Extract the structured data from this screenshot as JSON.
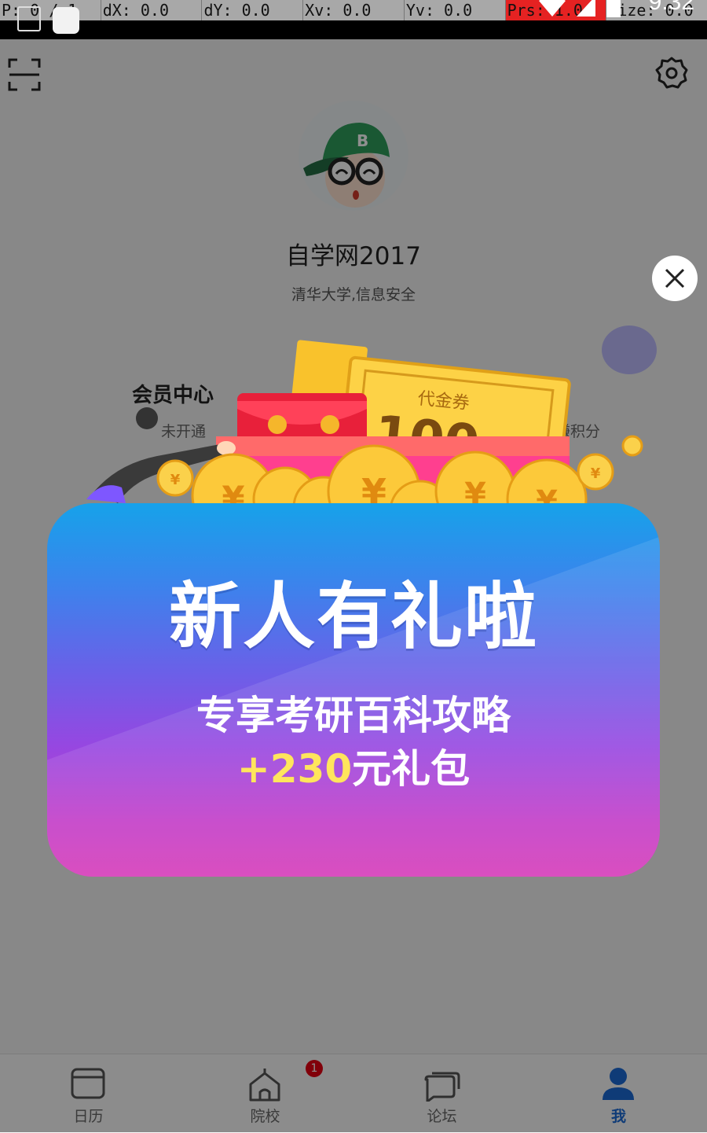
{
  "debug_bar": {
    "pointer": "P: 0 / 1",
    "dx": "dX: 0.0",
    "dy": "dY: 0.0",
    "xv": "Xv: 0.0",
    "yv": "Yv: 0.0",
    "prs": "Prs: 1.0",
    "size": "Size: 0.0"
  },
  "status_bar": {
    "time": "9:32"
  },
  "profile": {
    "username": "自学网2017",
    "school": "清华大学,信息安全",
    "vip_title": "会员中心",
    "vip_status": "未开通",
    "points_label": "赚积分"
  },
  "popup": {
    "headline": "新人有礼啦",
    "subtitle": "专享考研百科攻略",
    "gift_amount": "+230",
    "gift_suffix": "元礼包",
    "voucher_label": "代金券",
    "voucher_value": "100"
  },
  "tabs": [
    {
      "label": "日历",
      "icon": "calendar-icon"
    },
    {
      "label": "院校",
      "icon": "school-icon",
      "badge": "1"
    },
    {
      "label": "论坛",
      "icon": "forum-icon"
    },
    {
      "label": "我",
      "icon": "person-icon",
      "active": true
    }
  ],
  "colors": {
    "accent": "#1c6ad4",
    "badge": "#e60012",
    "popup_top": "#16a2ea",
    "popup_bottom": "#d63ab8",
    "gift_amount": "#ffe55c"
  }
}
